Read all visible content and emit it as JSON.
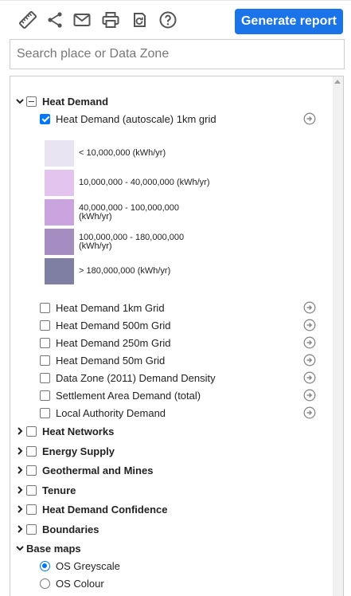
{
  "toolbar": {
    "icons": [
      "ruler-icon",
      "share-icon",
      "email-icon",
      "print-icon",
      "reset-icon",
      "help-icon"
    ],
    "generate_label": "Generate report"
  },
  "search": {
    "placeholder": "Search place or Data Zone",
    "value": ""
  },
  "layers": {
    "heat_demand": {
      "label": "Heat Demand",
      "state": "indeterminate",
      "expanded": true,
      "items": [
        {
          "label": "Heat Demand (autoscale) 1km grid",
          "checked": true
        },
        {
          "label": "Heat Demand 1km Grid",
          "checked": false
        },
        {
          "label": "Heat Demand 500m Grid",
          "checked": false
        },
        {
          "label": "Heat Demand 250m Grid",
          "checked": false
        },
        {
          "label": "Heat Demand 50m Grid",
          "checked": false
        },
        {
          "label": "Data Zone (2011) Demand Density",
          "checked": false
        },
        {
          "label": "Settlement Area Demand (total)",
          "checked": false
        },
        {
          "label": "Local Authority Demand",
          "checked": false
        }
      ],
      "legend": [
        {
          "label": "< 10,000,000 (kWh/yr)",
          "color": "#e8e4f2"
        },
        {
          "label": "10,000,000 - 40,000,000 (kWh/yr)",
          "color": "#e2c4ee"
        },
        {
          "label": "40,000,000 - 100,000,000 (kWh/yr)",
          "color": "#c9a4de"
        },
        {
          "label": "100,000,000 - 180,000,000 (kWh/yr)",
          "color": "#a58dc2"
        },
        {
          "label": "> 180,000,000 (kWh/yr)",
          "color": "#7e7fa3"
        }
      ]
    },
    "groups": [
      {
        "label": "Heat Networks"
      },
      {
        "label": "Energy Supply"
      },
      {
        "label": "Geothermal and Mines"
      },
      {
        "label": "Tenure"
      },
      {
        "label": "Heat Demand Confidence"
      },
      {
        "label": "Boundaries"
      }
    ],
    "base_maps": {
      "label": "Base maps",
      "options": [
        {
          "label": "OS Greyscale",
          "selected": true
        },
        {
          "label": "OS Colour",
          "selected": false
        }
      ]
    }
  },
  "colors": {
    "accent": "#1a73e8",
    "checkbox": "#0075ff",
    "icon": "#555555"
  }
}
